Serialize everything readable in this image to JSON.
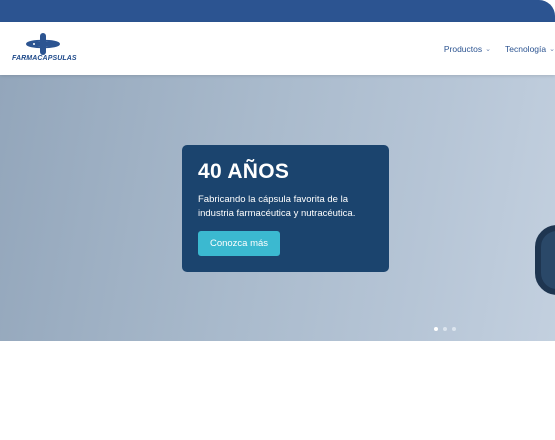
{
  "brand": {
    "name": "FARMACAPSULAS",
    "icon": "cross-capsule-logo"
  },
  "nav": {
    "items": [
      {
        "label": "Productos",
        "icon": "chevron-down-icon"
      },
      {
        "label": "Tecnología",
        "icon": "chevron-down-icon"
      }
    ]
  },
  "hero": {
    "title": "40 AÑOS",
    "text": "Fabricando la cápsula favorita de la industria farmacéutica y nutracéutica.",
    "button_label": "Conozca más",
    "slides_total": 3,
    "active_slide": 1
  },
  "colors": {
    "topbar": "#2c5491",
    "card": "#1b446e",
    "button": "#3bb9d0",
    "nav_text": "#2c5491"
  }
}
